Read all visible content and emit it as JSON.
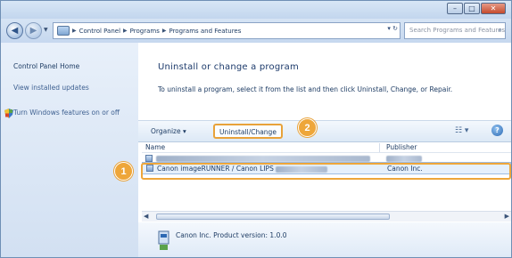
{
  "window": {
    "controls": [
      "–",
      "□",
      "✕"
    ]
  },
  "nav": {
    "back_icon": "back-arrow-icon",
    "forward_icon": "forward-arrow-icon",
    "breadcrumbs": [
      "Control Panel",
      "Programs",
      "Programs and Features"
    ],
    "search_placeholder": "Search Programs and Features"
  },
  "sidebar": {
    "items": [
      {
        "label": "Control Panel Home"
      },
      {
        "label": "View installed updates"
      },
      {
        "label": "Turn Windows features on or off"
      }
    ]
  },
  "main": {
    "title": "Uninstall or change a program",
    "description": "To uninstall a program, select it from the list and then click Uninstall, Change, or Repair."
  },
  "toolbar": {
    "organize_label": "Organize ▾",
    "uninstall_label": "Uninstall/Change",
    "views_label": "☷ ▾",
    "help_label": "?"
  },
  "list": {
    "columns": [
      "Name",
      "Publisher"
    ],
    "rows": [
      {
        "name": "",
        "publisher": ""
      },
      {
        "name": "Canon imageRUNNER / Canon LIPS",
        "publisher": "Canon Inc.",
        "selected": true
      }
    ]
  },
  "details": {
    "text": "Canon Inc.  Product version: 1.0.0"
  },
  "annotations": [
    {
      "number": "1"
    },
    {
      "number": "2"
    }
  ],
  "colors": {
    "accent_orange": "#eea63a",
    "chrome_blue": "#c6d8ef",
    "text_blue": "#1e3c64"
  }
}
